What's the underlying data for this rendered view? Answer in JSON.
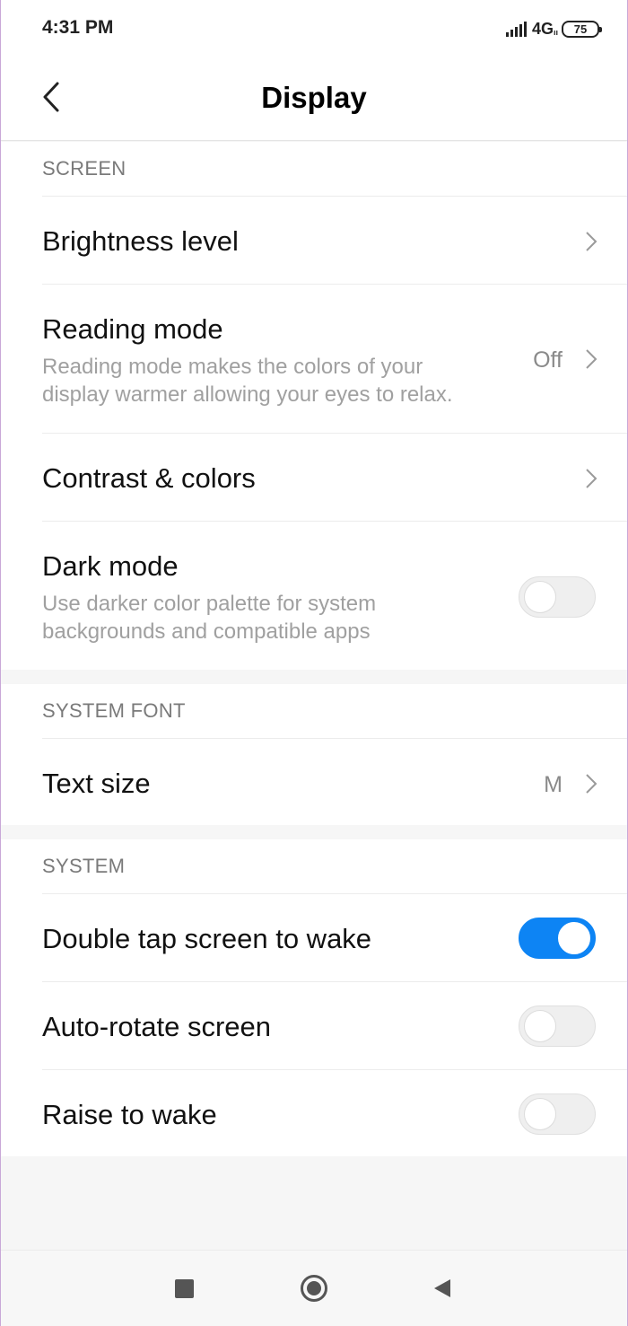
{
  "status_bar": {
    "time": "4:31 PM",
    "network": "4G",
    "network_sub": "ıı",
    "battery": "75",
    "icons": [
      "signal-icon",
      "battery-icon"
    ]
  },
  "header": {
    "title": "Display",
    "back_icon": "chevron-left-icon"
  },
  "sections": {
    "screen": {
      "header": "SCREEN",
      "brightness": {
        "title": "Brightness level"
      },
      "reading_mode": {
        "title": "Reading mode",
        "desc_line1": "Reading mode makes the colors of your",
        "desc_line2": "display warmer allowing your eyes to relax.",
        "value": "Off"
      },
      "contrast": {
        "title": "Contrast & colors"
      },
      "dark_mode": {
        "title": "Dark mode",
        "desc_line1": "Use darker color palette for system",
        "desc_line2": "backgrounds and compatible apps",
        "enabled": false
      }
    },
    "system_font": {
      "header": "SYSTEM FONT",
      "text_size": {
        "title": "Text size",
        "value": "M"
      }
    },
    "system": {
      "header": "SYSTEM",
      "double_tap": {
        "title": "Double tap screen to wake",
        "enabled": true
      },
      "auto_rotate": {
        "title": "Auto-rotate screen",
        "enabled": false
      },
      "raise_to_wake": {
        "title": "Raise to wake",
        "enabled": false
      }
    }
  },
  "nav_bar": {
    "icons": [
      "recents-square-icon",
      "home-circle-icon",
      "back-triangle-icon"
    ]
  },
  "colors": {
    "accent": "#0d84f4",
    "background": "#f6f6f6",
    "secondary_text": "#a0a0a0",
    "section_header": "#7a7a7a"
  }
}
